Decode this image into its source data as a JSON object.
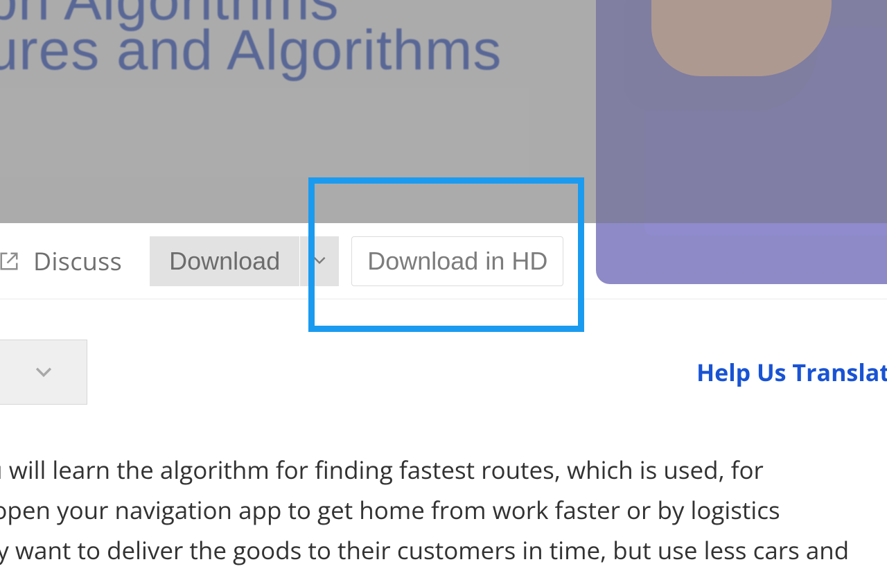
{
  "hero": {
    "title_line1": "Graph Algorithms",
    "title_line2": "ructures and Algorithms"
  },
  "toolbar": {
    "discuss_label": "Discuss",
    "download_label": "Download",
    "download_hd_label": "Download in HD"
  },
  "secondary": {
    "help_translate_label": "Help Us Translat"
  },
  "body": {
    "line1": "ure, you will learn the algorithm for finding fastest routes, which is used, for",
    "line2": "en you open your navigation app to get home from work faster or by logistics",
    "line3": "hen they want to deliver the goods to their customers in time, but use less cars and"
  }
}
